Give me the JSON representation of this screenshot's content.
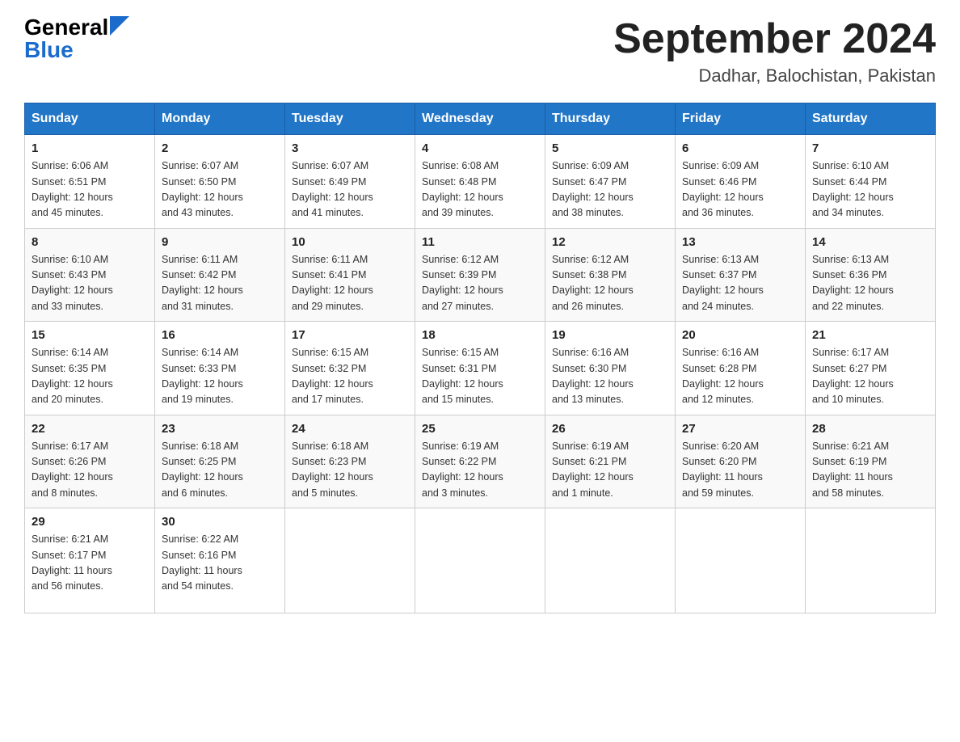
{
  "header": {
    "logo_general": "General",
    "logo_blue": "Blue",
    "month_title": "September 2024",
    "location": "Dadhar, Balochistan, Pakistan"
  },
  "days_of_week": [
    "Sunday",
    "Monday",
    "Tuesday",
    "Wednesday",
    "Thursday",
    "Friday",
    "Saturday"
  ],
  "weeks": [
    [
      {
        "day": "1",
        "sunrise": "6:06 AM",
        "sunset": "6:51 PM",
        "daylight": "12 hours and 45 minutes."
      },
      {
        "day": "2",
        "sunrise": "6:07 AM",
        "sunset": "6:50 PM",
        "daylight": "12 hours and 43 minutes."
      },
      {
        "day": "3",
        "sunrise": "6:07 AM",
        "sunset": "6:49 PM",
        "daylight": "12 hours and 41 minutes."
      },
      {
        "day": "4",
        "sunrise": "6:08 AM",
        "sunset": "6:48 PM",
        "daylight": "12 hours and 39 minutes."
      },
      {
        "day": "5",
        "sunrise": "6:09 AM",
        "sunset": "6:47 PM",
        "daylight": "12 hours and 38 minutes."
      },
      {
        "day": "6",
        "sunrise": "6:09 AM",
        "sunset": "6:46 PM",
        "daylight": "12 hours and 36 minutes."
      },
      {
        "day": "7",
        "sunrise": "6:10 AM",
        "sunset": "6:44 PM",
        "daylight": "12 hours and 34 minutes."
      }
    ],
    [
      {
        "day": "8",
        "sunrise": "6:10 AM",
        "sunset": "6:43 PM",
        "daylight": "12 hours and 33 minutes."
      },
      {
        "day": "9",
        "sunrise": "6:11 AM",
        "sunset": "6:42 PM",
        "daylight": "12 hours and 31 minutes."
      },
      {
        "day": "10",
        "sunrise": "6:11 AM",
        "sunset": "6:41 PM",
        "daylight": "12 hours and 29 minutes."
      },
      {
        "day": "11",
        "sunrise": "6:12 AM",
        "sunset": "6:39 PM",
        "daylight": "12 hours and 27 minutes."
      },
      {
        "day": "12",
        "sunrise": "6:12 AM",
        "sunset": "6:38 PM",
        "daylight": "12 hours and 26 minutes."
      },
      {
        "day": "13",
        "sunrise": "6:13 AM",
        "sunset": "6:37 PM",
        "daylight": "12 hours and 24 minutes."
      },
      {
        "day": "14",
        "sunrise": "6:13 AM",
        "sunset": "6:36 PM",
        "daylight": "12 hours and 22 minutes."
      }
    ],
    [
      {
        "day": "15",
        "sunrise": "6:14 AM",
        "sunset": "6:35 PM",
        "daylight": "12 hours and 20 minutes."
      },
      {
        "day": "16",
        "sunrise": "6:14 AM",
        "sunset": "6:33 PM",
        "daylight": "12 hours and 19 minutes."
      },
      {
        "day": "17",
        "sunrise": "6:15 AM",
        "sunset": "6:32 PM",
        "daylight": "12 hours and 17 minutes."
      },
      {
        "day": "18",
        "sunrise": "6:15 AM",
        "sunset": "6:31 PM",
        "daylight": "12 hours and 15 minutes."
      },
      {
        "day": "19",
        "sunrise": "6:16 AM",
        "sunset": "6:30 PM",
        "daylight": "12 hours and 13 minutes."
      },
      {
        "day": "20",
        "sunrise": "6:16 AM",
        "sunset": "6:28 PM",
        "daylight": "12 hours and 12 minutes."
      },
      {
        "day": "21",
        "sunrise": "6:17 AM",
        "sunset": "6:27 PM",
        "daylight": "12 hours and 10 minutes."
      }
    ],
    [
      {
        "day": "22",
        "sunrise": "6:17 AM",
        "sunset": "6:26 PM",
        "daylight": "12 hours and 8 minutes."
      },
      {
        "day": "23",
        "sunrise": "6:18 AM",
        "sunset": "6:25 PM",
        "daylight": "12 hours and 6 minutes."
      },
      {
        "day": "24",
        "sunrise": "6:18 AM",
        "sunset": "6:23 PM",
        "daylight": "12 hours and 5 minutes."
      },
      {
        "day": "25",
        "sunrise": "6:19 AM",
        "sunset": "6:22 PM",
        "daylight": "12 hours and 3 minutes."
      },
      {
        "day": "26",
        "sunrise": "6:19 AM",
        "sunset": "6:21 PM",
        "daylight": "12 hours and 1 minute."
      },
      {
        "day": "27",
        "sunrise": "6:20 AM",
        "sunset": "6:20 PM",
        "daylight": "11 hours and 59 minutes."
      },
      {
        "day": "28",
        "sunrise": "6:21 AM",
        "sunset": "6:19 PM",
        "daylight": "11 hours and 58 minutes."
      }
    ],
    [
      {
        "day": "29",
        "sunrise": "6:21 AM",
        "sunset": "6:17 PM",
        "daylight": "11 hours and 56 minutes."
      },
      {
        "day": "30",
        "sunrise": "6:22 AM",
        "sunset": "6:16 PM",
        "daylight": "11 hours and 54 minutes."
      },
      null,
      null,
      null,
      null,
      null
    ]
  ],
  "labels": {
    "sunrise": "Sunrise:",
    "sunset": "Sunset:",
    "daylight": "Daylight:"
  }
}
